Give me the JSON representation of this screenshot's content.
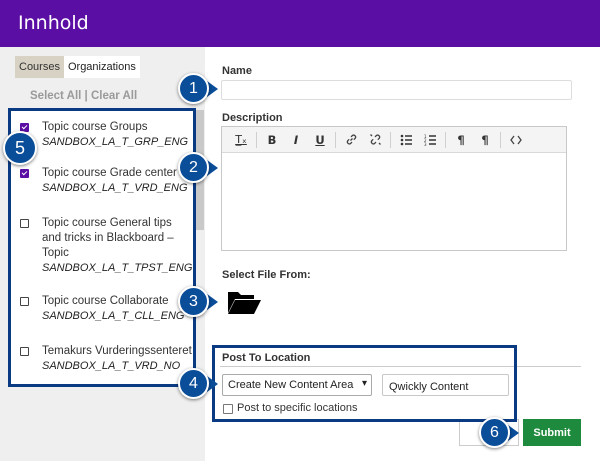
{
  "header": {
    "title": "Innhold"
  },
  "tabs": [
    {
      "label": "Courses",
      "active": true
    },
    {
      "label": "Organizations",
      "active": false
    }
  ],
  "select_links": {
    "select_all": "Select All",
    "separator": " | ",
    "clear_all": "Clear All"
  },
  "courses": [
    {
      "name": "Topic course Groups",
      "code": "SANDBOX_LA_T_GRP_ENG",
      "checked": true
    },
    {
      "name": "Topic course Grade center",
      "code": "SANDBOX_LA_T_VRD_ENG",
      "checked": true
    },
    {
      "name": "Topic course General tips and tricks in Blackboard – Topic",
      "code": "SANDBOX_LA_T_TPST_ENG",
      "checked": false
    },
    {
      "name": "Topic course Collaborate",
      "code": "SANDBOX_LA_T_CLL_ENG",
      "checked": false
    },
    {
      "name": "Temakurs Vurderingssenteret",
      "code": "SANDBOX_LA_T_VRD_NO",
      "checked": false
    }
  ],
  "form": {
    "name_label": "Name",
    "name_value": "",
    "description_label": "Description",
    "toolbar": [
      {
        "icon": "clear-format-icon",
        "glyph": "T̲ₓ"
      },
      {
        "icon": "bold-icon",
        "glyph": "B"
      },
      {
        "icon": "italic-icon",
        "glyph": "I"
      },
      {
        "icon": "underline-icon",
        "glyph": "U"
      },
      {
        "icon": "link-icon",
        "glyph": "🔗"
      },
      {
        "icon": "unlink-icon",
        "glyph": "⛓"
      },
      {
        "icon": "bullet-list-icon",
        "glyph": "☰"
      },
      {
        "icon": "numbered-list-icon",
        "glyph": "≡"
      },
      {
        "icon": "paragraph-ltr-icon",
        "glyph": "¶"
      },
      {
        "icon": "paragraph-rtl-icon",
        "glyph": "¶"
      },
      {
        "icon": "source-code-icon",
        "glyph": "‹›"
      }
    ],
    "select_file_label": "Select File From:",
    "file_icon": "folder-open-icon"
  },
  "post_to_location": {
    "label": "Post To Location",
    "select_value": "Create New Content Area",
    "content_area_name": "Qwickly Content",
    "specific_locations_label": "Post to specific locations",
    "specific_locations_checked": false
  },
  "actions": {
    "submit_label": "Submit"
  },
  "callouts": [
    "1",
    "2",
    "3",
    "4",
    "5",
    "6"
  ],
  "colors": {
    "header_bg": "#5b0ea3",
    "callout_bg": "#0a4d99",
    "highlight_border": "#0a3a82",
    "submit_bg": "#1e8a3d"
  }
}
